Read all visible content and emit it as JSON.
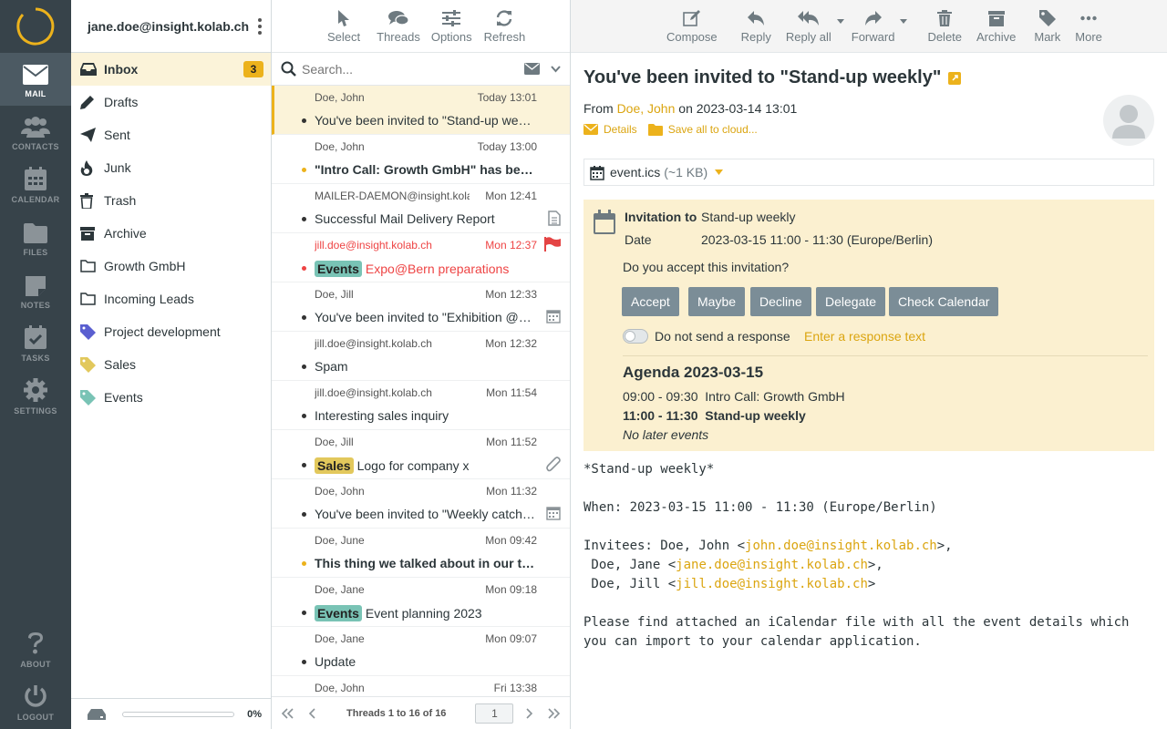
{
  "nav": {
    "items": [
      {
        "label": "MAIL",
        "icon": "envelope-icon"
      },
      {
        "label": "CONTACTS",
        "icon": "contacts-icon"
      },
      {
        "label": "CALENDAR",
        "icon": "calendar-icon"
      },
      {
        "label": "FILES",
        "icon": "folder-icon"
      },
      {
        "label": "NOTES",
        "icon": "note-icon"
      },
      {
        "label": "TASKS",
        "icon": "tasks-icon"
      },
      {
        "label": "SETTINGS",
        "icon": "gear-icon"
      }
    ],
    "about": "ABOUT",
    "logout": "LOGOUT"
  },
  "user": "jane.doe@insight.kolab.ch",
  "folders": [
    {
      "label": "Inbox",
      "badge": "3"
    },
    {
      "label": "Drafts"
    },
    {
      "label": "Sent"
    },
    {
      "label": "Junk"
    },
    {
      "label": "Trash"
    },
    {
      "label": "Archive"
    },
    {
      "label": "Growth GmbH"
    },
    {
      "label": "Incoming Leads"
    },
    {
      "label": "Project development"
    },
    {
      "label": "Sales"
    },
    {
      "label": "Events"
    }
  ],
  "quota": "0%",
  "list_toolbar": {
    "select": "Select",
    "threads": "Threads",
    "options": "Options",
    "refresh": "Refresh"
  },
  "search": {
    "placeholder": "Search..."
  },
  "messages": [
    {
      "from": "Doe, John",
      "date": "Today 13:01",
      "subject": "You've been invited to \"Stand-up weekly\""
    },
    {
      "from": "Doe, John",
      "date": "Today 13:00",
      "subject": "\"Intro Call: Growth GmbH\" has been accepted"
    },
    {
      "from": "MAILER-DAEMON@insight.kolab.ch",
      "date": "Mon 12:41",
      "subject": "Successful Mail Delivery Report"
    },
    {
      "from": "jill.doe@insight.kolab.ch",
      "date": "Mon 12:37",
      "tag": "Events",
      "subject": "Expo@Bern preparations"
    },
    {
      "from": "Doe, Jill",
      "date": "Mon 12:33",
      "subject": "You've been invited to \"Exhibition @Bern\""
    },
    {
      "from": "jill.doe@insight.kolab.ch",
      "date": "Mon 12:32",
      "subject": "Spam"
    },
    {
      "from": "jill.doe@insight.kolab.ch",
      "date": "Mon 11:54",
      "subject": "Interesting sales inquiry"
    },
    {
      "from": "Doe, Jill",
      "date": "Mon 11:52",
      "tag": "Sales",
      "subject": "Logo for company x"
    },
    {
      "from": "Doe, John",
      "date": "Mon 11:32",
      "subject": "You've been invited to \"Weekly catch-up\""
    },
    {
      "from": "Doe, June",
      "date": "Mon 09:42",
      "subject": "This thing we talked about in our test call"
    },
    {
      "from": "Doe, Jane",
      "date": "Mon 09:18",
      "tag": "Events",
      "subject": "Event planning 2023"
    },
    {
      "from": "Doe, Jane",
      "date": "Mon 09:07",
      "subject": "Update"
    },
    {
      "from": "Doe, John",
      "date": "Fri 13:38",
      "subject": ""
    }
  ],
  "list_footer": {
    "count": "Threads 1 to 16 of 16",
    "page": "1"
  },
  "msg_toolbar": {
    "compose": "Compose",
    "reply": "Reply",
    "reply_all": "Reply all",
    "forward": "Forward",
    "delete": "Delete",
    "archive": "Archive",
    "mark": "Mark",
    "more": "More"
  },
  "message": {
    "title": "You've been invited to \"Stand-up weekly\"",
    "from_prefix": "From",
    "from_name": "Doe, John",
    "from_date": "on 2023-03-14 13:01",
    "details": "Details",
    "save_cloud": "Save all to cloud...",
    "attachment_name": "event.ics",
    "attachment_size": "(~1 KB)"
  },
  "invitation": {
    "label_invitation": "Invitation to",
    "title": "Stand-up weekly",
    "label_date": "Date",
    "date": "2023-03-15 11:00 - 11:30 (Europe/Berlin)",
    "question": "Do you accept this invitation?",
    "buttons": [
      "Accept",
      "Maybe",
      "Decline",
      "Delegate",
      "Check Calendar"
    ],
    "no_response": "Do not send a response",
    "response_text": "Enter a response text",
    "agenda_title": "Agenda 2023-03-15",
    "agenda": [
      {
        "time": "09:00 - 09:30",
        "title": "Intro Call: Growth GmbH"
      },
      {
        "time": "11:00 - 11:30",
        "title": "Stand-up weekly"
      }
    ],
    "no_later": "No later events"
  },
  "body": {
    "line1": "*Stand-up weekly*",
    "when": "When: 2023-03-15 11:00 - 11:30 (Europe/Berlin)",
    "invitees_prefix": "Invitees: Doe, John <",
    "email1": "john.doe@insight.kolab.ch",
    "suffix1": ">,",
    "prefix2": " Doe, Jane <",
    "email2": "jane.doe@insight.kolab.ch",
    "suffix2": ">,",
    "prefix3": " Doe, Jill <",
    "email3": "jill.doe@insight.kolab.ch",
    "suffix3": ">",
    "para1": "Please find attached an iCalendar file with all the event details which",
    "para2": "you can import to your calendar application."
  },
  "colors": {
    "accent": "#ecb21c",
    "nav_bg": "#37434a",
    "flag": "#e44444",
    "tag_events": "#79c3b5",
    "tag_sales": "#e2c85c"
  }
}
